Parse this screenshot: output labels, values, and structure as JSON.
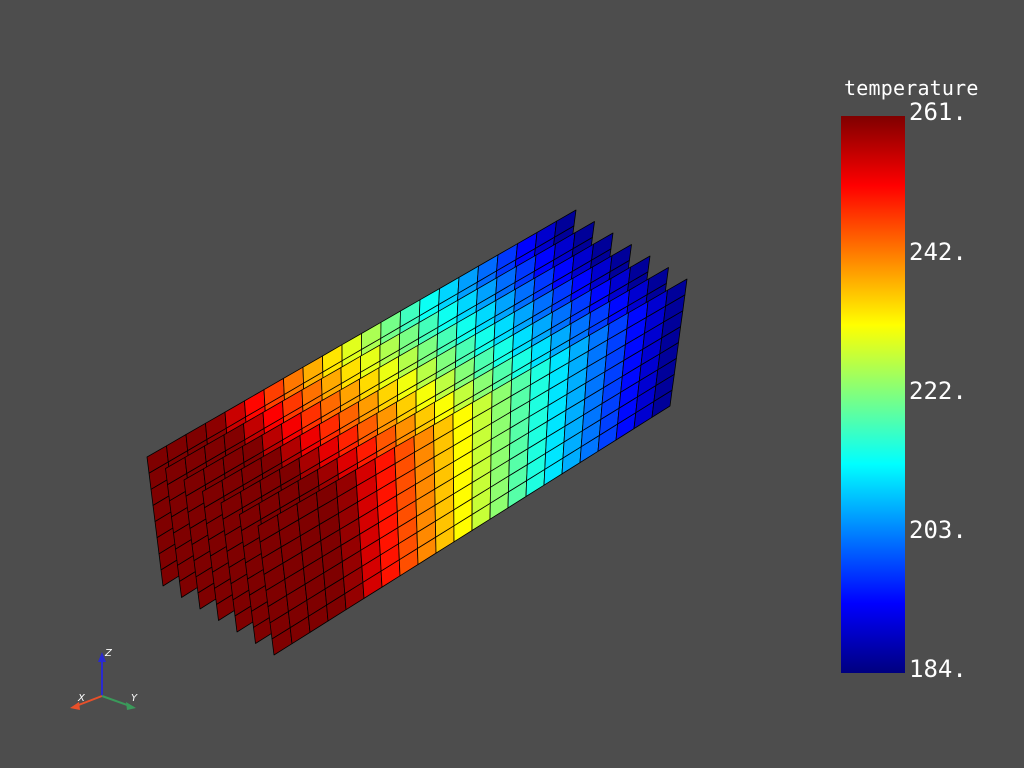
{
  "scalar_bar": {
    "title": "temperature",
    "ticks": [
      "261.",
      "242.",
      "222.",
      "203.",
      "184."
    ],
    "range": [
      184,
      261
    ],
    "colormap": "jet",
    "colors": [
      "#00007f",
      "#0000ff",
      "#007fff",
      "#00ffff",
      "#7fff7f",
      "#ffff00",
      "#ff7f00",
      "#ff0000",
      "#7f0000"
    ]
  },
  "render": {
    "background": "#4d4d4d",
    "mesh_edge_color": "#000000",
    "slice_count": 7,
    "columns": 22,
    "rows": 8,
    "temperature_along_length": [
      261,
      184
    ]
  },
  "axes": {
    "x_label": "X",
    "y_label": "Y",
    "z_label": "Z",
    "x_color": "#e8502a",
    "y_color": "#3a9a5a",
    "z_color": "#2a2ad0"
  }
}
